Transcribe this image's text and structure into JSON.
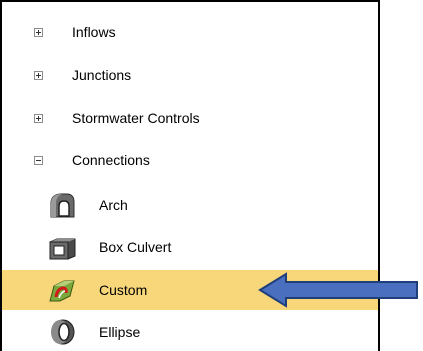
{
  "tree": {
    "groups": [
      {
        "label": "Inflows",
        "expander": "plus"
      },
      {
        "label": "Junctions",
        "expander": "plus"
      },
      {
        "label": "Stormwater Controls",
        "expander": "plus"
      },
      {
        "label": "Connections",
        "expander": "minus"
      }
    ],
    "children": [
      {
        "label": "Arch",
        "icon": "arch-conduit-icon"
      },
      {
        "label": "Box Culvert",
        "icon": "box-culvert-icon"
      },
      {
        "label": "Custom",
        "icon": "custom-shape-icon",
        "selected": true
      },
      {
        "label": "Ellipse",
        "icon": "ellipse-conduit-icon"
      }
    ]
  },
  "colors": {
    "selection": "#f8d77a",
    "arrow_fill": "#4a6fbf",
    "arrow_stroke": "#1f3f7a"
  }
}
